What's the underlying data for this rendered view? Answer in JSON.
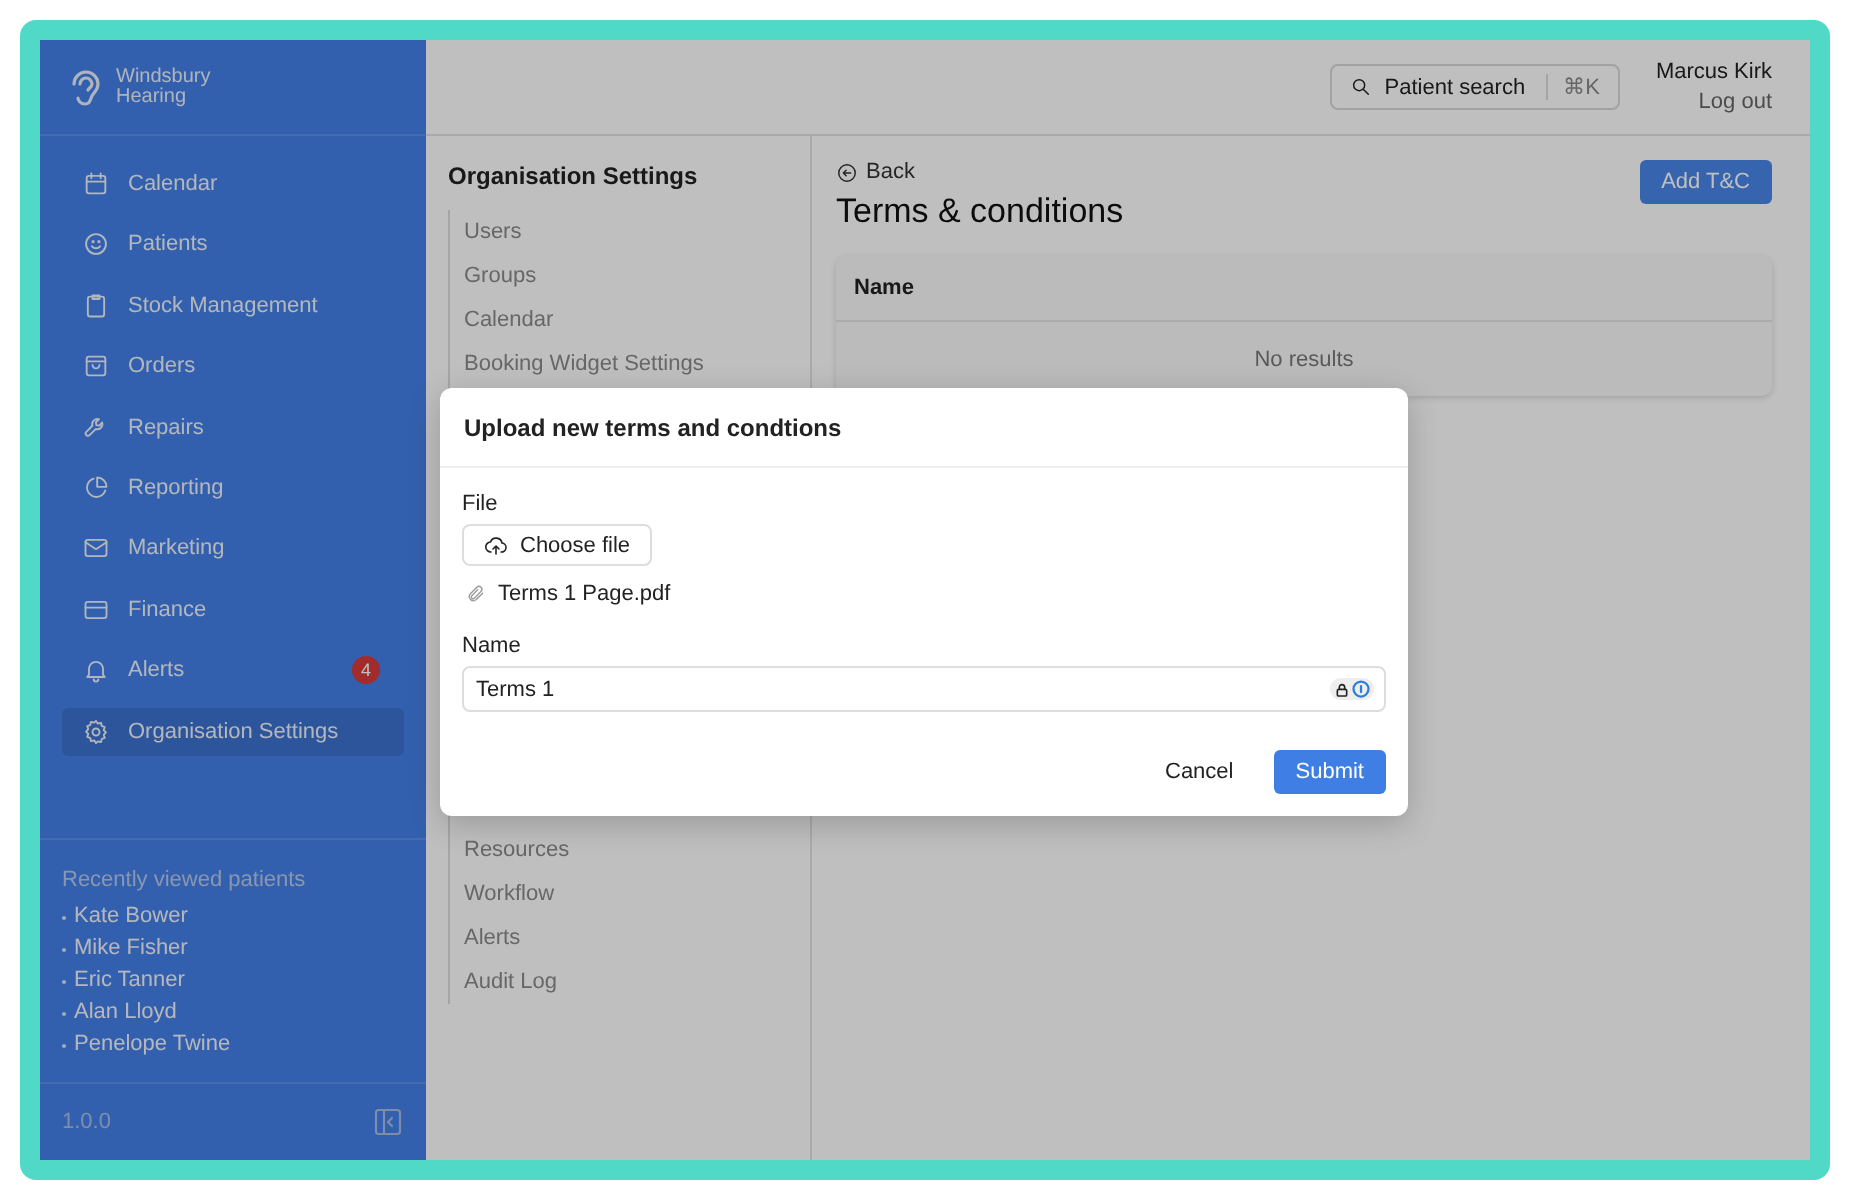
{
  "sidebar": {
    "brand_lines": [
      "Windsbury",
      "Hearing"
    ],
    "nav_items": [
      {
        "label": "Calendar",
        "selected": false
      },
      {
        "label": "Patients",
        "selected": false
      },
      {
        "label": "Stock Management",
        "selected": false
      },
      {
        "label": "Orders",
        "selected": false
      },
      {
        "label": "Repairs",
        "selected": false
      },
      {
        "label": "Reporting",
        "selected": false
      },
      {
        "label": "Marketing",
        "selected": false
      },
      {
        "label": "Finance",
        "selected": false
      },
      {
        "label": "Alerts",
        "selected": false,
        "badge": "4"
      },
      {
        "label": "Organisation Settings",
        "selected": true
      }
    ],
    "recent_title": "Recently viewed patients",
    "recent_patients": [
      "Kate Bower",
      "Mike Fisher",
      "Eric Tanner",
      "Alan Lloyd",
      "Penelope Twine"
    ],
    "version": "1.0.0"
  },
  "topbar": {
    "search_label": "Patient search",
    "shortcut": "⌘K",
    "user_name": "Marcus Kirk",
    "logout": "Log out"
  },
  "settings_nav": {
    "title": "Organisation Settings",
    "items_top": [
      "Users",
      "Groups",
      "Calendar",
      "Booking Widget Settings"
    ],
    "items_bottom": [
      "Resources",
      "Workflow",
      "Alerts",
      "Audit Log"
    ]
  },
  "page": {
    "back": "Back",
    "title": "Terms & conditions",
    "add_button": "Add T&C",
    "table": {
      "columns": [
        "Name"
      ],
      "empty_text": "No results"
    }
  },
  "dialog": {
    "title": "Upload new terms and condtions",
    "file_label": "File",
    "choose_button": "Choose file",
    "file_name": "Terms 1 Page.pdf",
    "name_label": "Name",
    "name_value": "Terms 1",
    "cancel": "Cancel",
    "submit": "Submit"
  }
}
